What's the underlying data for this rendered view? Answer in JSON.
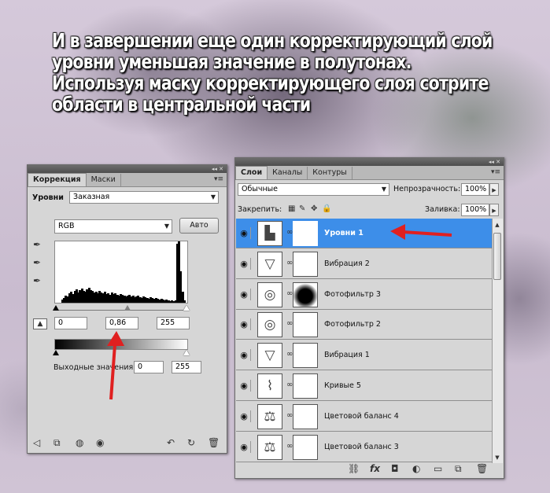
{
  "headline": "И в завершении еще один корректирующий слой уровни уменьшая значение в полутонах. Используя маску корректирующего слоя сотрите области в центральной части",
  "adjustments_panel": {
    "collapse_glyph": "◂◂ ✕",
    "tabs": [
      "Коррекция",
      "Маски"
    ],
    "preset_label": "Уровни",
    "preset_value": "Заказная",
    "channel_value": "RGB",
    "auto_button": "Авто",
    "input_black": "0",
    "input_gamma": "0,86",
    "input_white": "255",
    "output_label": "Выходные значения:",
    "output_black": "0",
    "output_white": "255"
  },
  "layers_panel": {
    "collapse_glyph": "◂◂ ✕",
    "tabs": [
      "Слои",
      "Каналы",
      "Контуры"
    ],
    "blend_mode": "Обычные",
    "opacity_label": "Непрозрачность:",
    "opacity_value": "100%",
    "lock_label": "Закрепить:",
    "fill_label": "Заливка:",
    "fill_value": "100%",
    "layers": [
      {
        "name": "Уровни 1",
        "icon": "levels-icon",
        "selected": true,
        "mask": "white"
      },
      {
        "name": "Вибрация 2",
        "icon": "vibrance-icon",
        "selected": false,
        "mask": "white"
      },
      {
        "name": "Фотофильтр 3",
        "icon": "photo-filter-icon",
        "selected": false,
        "mask": "black-spot"
      },
      {
        "name": "Фотофильтр 2",
        "icon": "photo-filter-icon",
        "selected": false,
        "mask": "white"
      },
      {
        "name": "Вибрация 1",
        "icon": "vibrance-icon",
        "selected": false,
        "mask": "white"
      },
      {
        "name": "Кривые 5",
        "icon": "curves-icon",
        "selected": false,
        "mask": "white"
      },
      {
        "name": "Цветовой баланс 4",
        "icon": "color-balance-icon",
        "selected": false,
        "mask": "white"
      },
      {
        "name": "Цветовой баланс 3",
        "icon": "color-balance-icon",
        "selected": false,
        "mask": "white"
      }
    ]
  },
  "colors": {
    "selection": "#3d8ee9",
    "annotation_arrow": "#e02020"
  }
}
